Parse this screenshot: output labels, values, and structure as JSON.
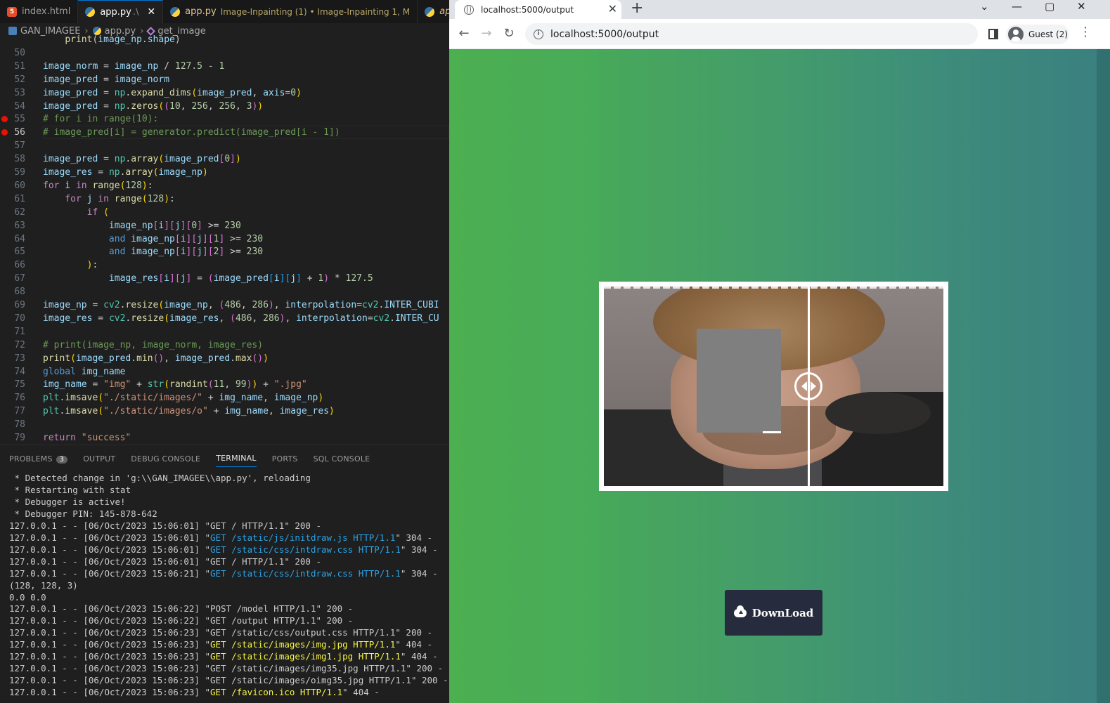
{
  "editor_tabs": [
    {
      "label": "index.html",
      "type": "html"
    },
    {
      "label": "app.py",
      "suffix": ".\\",
      "type": "py",
      "active": true
    },
    {
      "label": "app.py",
      "desc": "Image-Inpainting (1) • Image-Inpainting  1, M",
      "type": "py",
      "modified": true
    },
    {
      "label": "app.py",
      "type": "py",
      "italic": true
    }
  ],
  "breadcrumb": {
    "folder": "GAN_IMAGEE",
    "file": "app.py",
    "symbol": "get_image"
  },
  "code_lines": [
    {
      "num": "",
      "html": "    <span class='f'>print</span>(<span class='v'>image_np</span>.<span class='v'>shape</span>)"
    },
    {
      "num": "50",
      "html": ""
    },
    {
      "num": "51",
      "html": "<span class='v'>image_norm</span> = <span class='v'>image_np</span> / <span class='n'>127.5</span> - <span class='n'>1</span>"
    },
    {
      "num": "52",
      "html": "<span class='v'>image_pred</span> = <span class='v'>image_norm</span>"
    },
    {
      "num": "53",
      "html": "<span class='v'>image_pred</span> = <span class='cl'>np</span>.<span class='f'>expand_dims</span><span class='y'>(</span><span class='v'>image_pred</span>, <span class='v'>axis</span>=<span class='n'>0</span><span class='y'>)</span>"
    },
    {
      "num": "54",
      "html": "<span class='v'>image_pred</span> = <span class='cl'>np</span>.<span class='f'>zeros</span><span class='y'>(</span><span class='p'>(</span><span class='n'>10</span>, <span class='n'>256</span>, <span class='n'>256</span>, <span class='n'>3</span><span class='p'>)</span><span class='y'>)</span>"
    },
    {
      "num": "55",
      "bp": true,
      "html": "<span class='c'># for i in range(10):</span>"
    },
    {
      "num": "56",
      "bp": true,
      "current": true,
      "html": "<span class='c'># image_pred[i] = generator.predict(image_pred[i - 1])</span>"
    },
    {
      "num": "57",
      "html": ""
    },
    {
      "num": "58",
      "html": "<span class='v'>image_pred</span> = <span class='cl'>np</span>.<span class='f'>array</span><span class='y'>(</span><span class='v'>image_pred</span><span class='p'>[</span><span class='n'>0</span><span class='p'>]</span><span class='y'>)</span>"
    },
    {
      "num": "59",
      "html": "<span class='v'>image_res</span> = <span class='cl'>np</span>.<span class='f'>array</span><span class='y'>(</span><span class='v'>image_np</span><span class='y'>)</span>"
    },
    {
      "num": "60",
      "html": "<span class='k'>for</span> <span class='v'>i</span> <span class='k'>in</span> <span class='f'>range</span><span class='y'>(</span><span class='n'>128</span><span class='y'>)</span>:"
    },
    {
      "num": "61",
      "html": "    <span class='k'>for</span> <span class='v'>j</span> <span class='k'>in</span> <span class='f'>range</span><span class='y'>(</span><span class='n'>128</span><span class='y'>)</span>:"
    },
    {
      "num": "62",
      "html": "        <span class='k'>if</span> <span class='y'>(</span>"
    },
    {
      "num": "63",
      "html": "            <span class='v'>image_np</span><span class='p'>[</span><span class='v'>i</span><span class='p'>][</span><span class='v'>j</span><span class='p'>][</span><span class='n'>0</span><span class='p'>]</span> >= <span class='n'>230</span>"
    },
    {
      "num": "64",
      "html": "            <span class='kb'>and</span> <span class='v'>image_np</span><span class='p'>[</span><span class='v'>i</span><span class='p'>][</span><span class='v'>j</span><span class='p'>][</span><span class='n'>1</span><span class='p'>]</span> >= <span class='n'>230</span>"
    },
    {
      "num": "65",
      "html": "            <span class='kb'>and</span> <span class='v'>image_np</span><span class='p'>[</span><span class='v'>i</span><span class='p'>][</span><span class='v'>j</span><span class='p'>][</span><span class='n'>2</span><span class='p'>]</span> >= <span class='n'>230</span>"
    },
    {
      "num": "66",
      "html": "        <span class='y'>)</span>:"
    },
    {
      "num": "67",
      "html": "            <span class='v'>image_res</span><span class='p'>[</span><span class='v'>i</span><span class='p'>][</span><span class='v'>j</span><span class='p'>]</span> = <span class='p'>(</span><span class='v'>image_pred</span><span class='b'>[</span><span class='v'>i</span><span class='b'>][</span><span class='v'>j</span><span class='b'>]</span> + <span class='n'>1</span><span class='p'>)</span> * <span class='n'>127.5</span>"
    },
    {
      "num": "68",
      "html": ""
    },
    {
      "num": "69",
      "html": "<span class='v'>image_np</span> = <span class='cl'>cv2</span>.<span class='f'>resize</span><span class='y'>(</span><span class='v'>image_np</span>, <span class='p'>(</span><span class='n'>486</span>, <span class='n'>286</span><span class='p'>)</span>, <span class='v'>interpolation</span>=<span class='cl'>cv2</span>.<span class='v'>INTER_CUBI</span>"
    },
    {
      "num": "70",
      "html": "<span class='v'>image_res</span> = <span class='cl'>cv2</span>.<span class='f'>resize</span><span class='y'>(</span><span class='v'>image_res</span>, <span class='p'>(</span><span class='n'>486</span>, <span class='n'>286</span><span class='p'>)</span>, <span class='v'>interpolation</span>=<span class='cl'>cv2</span>.<span class='v'>INTER_CU</span>"
    },
    {
      "num": "71",
      "html": ""
    },
    {
      "num": "72",
      "html": "<span class='c'># print(image_np, image_norm, image_res)</span>"
    },
    {
      "num": "73",
      "html": "<span class='f'>print</span><span class='y'>(</span><span class='v'>image_pred</span>.<span class='f'>min</span><span class='p'>()</span>, <span class='v'>image_pred</span>.<span class='f'>max</span><span class='p'>()</span><span class='y'>)</span>"
    },
    {
      "num": "74",
      "html": "<span class='kb'>global</span> <span class='v'>img_name</span>"
    },
    {
      "num": "75",
      "html": "<span class='v'>img_name</span> = <span class='s'>\"img\"</span> + <span class='cl'>str</span><span class='y'>(</span><span class='f'>randint</span><span class='p'>(</span><span class='n'>11</span>, <span class='n'>99</span><span class='p'>)</span><span class='y'>)</span> + <span class='s'>\".jpg\"</span>"
    },
    {
      "num": "76",
      "html": "<span class='cl'>plt</span>.<span class='f'>imsave</span><span class='y'>(</span><span class='s'>\"./static/images/\"</span> + <span class='v'>img_name</span>, <span class='v'>image_np</span><span class='y'>)</span>"
    },
    {
      "num": "77",
      "html": "<span class='cl'>plt</span>.<span class='f'>imsave</span><span class='y'>(</span><span class='s'>\"./static/images/o\"</span> + <span class='v'>img_name</span>, <span class='v'>image_res</span><span class='y'>)</span>"
    },
    {
      "num": "78",
      "html": ""
    },
    {
      "num": "79",
      "html": "<span class='k'>return</span> <span class='s'>\"success\"</span>"
    }
  ],
  "panel_tabs": [
    {
      "label": "PROBLEMS",
      "badge": "3"
    },
    {
      "label": "OUTPUT"
    },
    {
      "label": "DEBUG CONSOLE"
    },
    {
      "label": "TERMINAL",
      "active": true
    },
    {
      "label": "PORTS"
    },
    {
      "label": "SQL CONSOLE"
    }
  ],
  "terminal_lines": [
    {
      "text": " * Detected change in 'g:\\\\GAN_IMAGEE\\\\app.py', reloading"
    },
    {
      "text": " * Restarting with stat"
    },
    {
      "text": " * Debugger is active!"
    },
    {
      "text": " * Debugger PIN: 145-878-642"
    },
    {
      "pre": "127.0.0.1 - - [06/Oct/2023 15:06:01] \"GET / HTTP/1.1\" 200 -"
    },
    {
      "pre": "127.0.0.1 - - [06/Oct/2023 15:06:01] \"",
      "hl": "GET /static/js/initdraw.js HTTP/1.1",
      "color": "blue",
      "post": "\" 304 -"
    },
    {
      "pre": "127.0.0.1 - - [06/Oct/2023 15:06:01] \"",
      "hl": "GET /static/css/intdraw.css HTTP/1.1",
      "color": "blue",
      "post": "\" 304 -"
    },
    {
      "pre": "127.0.0.1 - - [06/Oct/2023 15:06:01] \"GET / HTTP/1.1\" 200 -"
    },
    {
      "pre": "127.0.0.1 - - [06/Oct/2023 15:06:21] \"",
      "hl": "GET /static/css/intdraw.css HTTP/1.1",
      "color": "blue",
      "post": "\" 304 -"
    },
    {
      "text": "(128, 128, 3)"
    },
    {
      "text": "0.0 0.0"
    },
    {
      "pre": "127.0.0.1 - - [06/Oct/2023 15:06:22] \"POST /model HTTP/1.1\" 200 -"
    },
    {
      "pre": "127.0.0.1 - - [06/Oct/2023 15:06:22] \"GET /output HTTP/1.1\" 200 -"
    },
    {
      "pre": "127.0.0.1 - - [06/Oct/2023 15:06:23] \"GET /static/css/output.css HTTP/1.1\" 200 -"
    },
    {
      "pre": "127.0.0.1 - - [06/Oct/2023 15:06:23] \"",
      "hl": "GET /static/images/img.jpg HTTP/1.1",
      "color": "yellow",
      "post": "\" 404 -"
    },
    {
      "pre": "127.0.0.1 - - [06/Oct/2023 15:06:23] \"",
      "hl": "GET /static/images/img1.jpg HTTP/1.1",
      "color": "yellow",
      "post": "\" 404 -"
    },
    {
      "pre": "127.0.0.1 - - [06/Oct/2023 15:06:23] \"GET /static/images/img35.jpg HTTP/1.1\" 200 -"
    },
    {
      "pre": "127.0.0.1 - - [06/Oct/2023 15:06:23] \"GET /static/images/oimg35.jpg HTTP/1.1\" 200 -"
    },
    {
      "pre": "127.0.0.1 - - [06/Oct/2023 15:06:23] \"",
      "hl": "GET /favicon.ico HTTP/1.1",
      "color": "yellow",
      "post": "\" 404 -"
    }
  ],
  "browser": {
    "tab_title": "localhost:5000/output",
    "url": "localhost:5000/output",
    "profile": "Guest (2)",
    "download_label": "DownLoad"
  },
  "colors": {
    "page_green": "#4caf50",
    "page_teal": "#3a8080",
    "button_bg": "#262b3d",
    "mask_gray": "#7f7f7f"
  }
}
